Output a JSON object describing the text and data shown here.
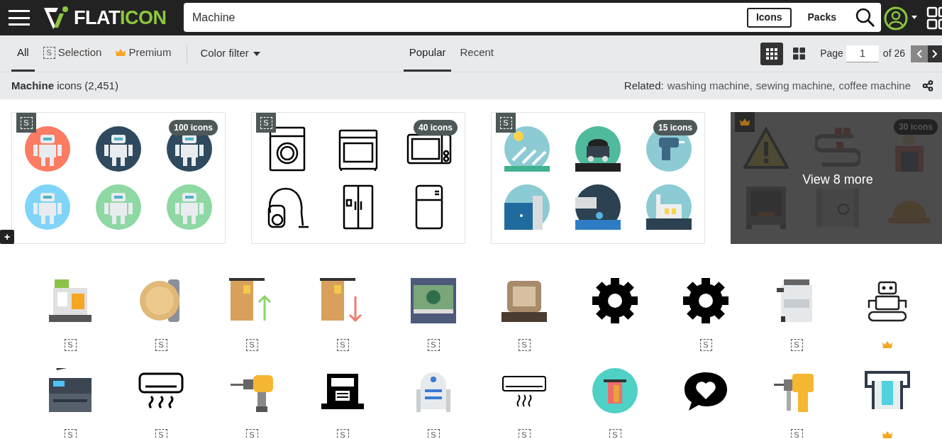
{
  "header": {
    "logo": [
      {
        "text": "FLAT",
        "color": "#ffffff"
      },
      {
        "text": "ICON",
        "color": "#8dc63f"
      }
    ],
    "search": {
      "value": "Machine"
    },
    "search_types": [
      {
        "label": "Icons",
        "selected": true
      },
      {
        "label": "Packs",
        "selected": false
      }
    ]
  },
  "filters": [
    {
      "kind": "plain",
      "label": "All",
      "selected": true
    },
    {
      "kind": "selection",
      "label": "Selection",
      "mark": "S",
      "selected": false
    },
    {
      "kind": "premium",
      "label": "Premium",
      "selected": false
    }
  ],
  "color_filter": "Color filter",
  "sort_tabs": [
    {
      "label": "Popular",
      "selected": true
    },
    {
      "label": "Recent",
      "selected": false
    }
  ],
  "view_modes": [
    {
      "kind": "small",
      "selected": true
    },
    {
      "kind": "large",
      "selected": false
    }
  ],
  "pagination": {
    "label": "Page",
    "value": "1",
    "total": "of 26"
  },
  "summary": "**Machine** icons (2,451)",
  "related": {
    "label": "Related:",
    "links": [
      "washing machine,",
      "sewing machine,",
      "coffee machine"
    ]
  },
  "packs": [
    {
      "kind": "selection",
      "mark": "S",
      "count": "100 icons"
    },
    {
      "kind": "selection",
      "mark": "S",
      "count": "40 icons"
    },
    {
      "kind": "selection",
      "mark": "S",
      "count": "15 icons"
    },
    {
      "kind": "premium",
      "count": "30 icons",
      "more": "View 8 more"
    }
  ],
  "expand_button": "+",
  "icons": [
    {
      "kind": "selection",
      "mark": "S"
    },
    {
      "kind": "selection",
      "mark": "S"
    },
    {
      "kind": "selection",
      "mark": "S"
    },
    {
      "kind": "selection",
      "mark": "S"
    },
    {
      "kind": "selection",
      "mark": "S"
    },
    {
      "kind": "selection",
      "mark": "S"
    },
    {
      "kind": "free"
    },
    {
      "kind": "selection",
      "mark": "S"
    },
    {
      "kind": "selection",
      "mark": "S"
    },
    {
      "kind": "premium"
    },
    {
      "kind": "selection",
      "mark": "S"
    },
    {
      "kind": "selection",
      "mark": "S"
    },
    {
      "kind": "selection",
      "mark": "S"
    },
    {
      "kind": "selection",
      "mark": "S"
    },
    {
      "kind": "selection",
      "mark": "S"
    },
    {
      "kind": "selection",
      "mark": "S"
    },
    {
      "kind": "selection",
      "mark": "S"
    },
    {
      "kind": "free"
    },
    {
      "kind": "selection",
      "mark": "S"
    },
    {
      "kind": "premium"
    }
  ]
}
